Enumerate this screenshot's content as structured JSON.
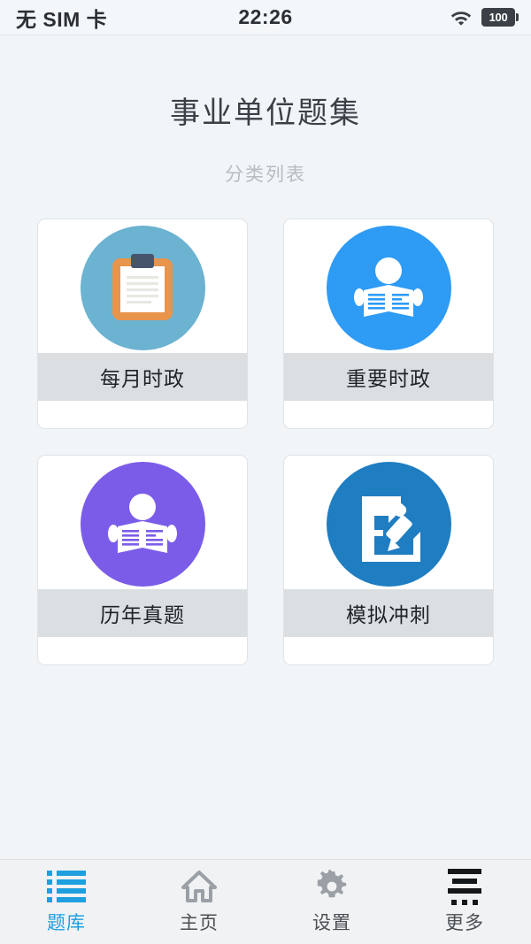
{
  "status_bar": {
    "carrier": "无 SIM 卡",
    "time": "22:26",
    "wifi_icon": "wifi-icon",
    "battery_level": "100"
  },
  "header": {
    "title": "事业单位题集",
    "subtitle": "分类列表"
  },
  "categories": [
    {
      "label": "每月时政",
      "icon": "clipboard-icon",
      "circle_color": "#6cb2d1",
      "accent_color": "#e8944a"
    },
    {
      "label": "重要时政",
      "icon": "reading-person-icon",
      "circle_color": "#2e9bf5",
      "accent_color": "#ffffff"
    },
    {
      "label": "历年真题",
      "icon": "reading-person-icon",
      "circle_color": "#7b5ce8",
      "accent_color": "#ffffff"
    },
    {
      "label": "模拟冲刺",
      "icon": "document-pen-icon",
      "circle_color": "#1f7dc2",
      "accent_color": "#ffffff"
    }
  ],
  "tabbar": {
    "active_color": "#1f9fe0",
    "inactive_color": "#4a4f54",
    "items": [
      {
        "label": "题库",
        "icon": "list-icon",
        "active": true
      },
      {
        "label": "主页",
        "icon": "home-icon",
        "active": false
      },
      {
        "label": "设置",
        "icon": "gear-icon",
        "active": false
      },
      {
        "label": "更多",
        "icon": "more-icon",
        "active": false
      }
    ]
  }
}
